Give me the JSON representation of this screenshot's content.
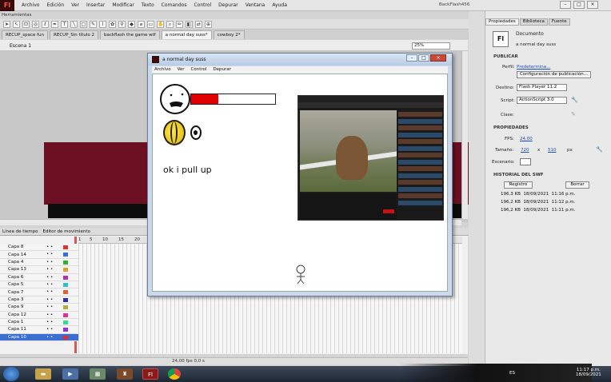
{
  "app": {
    "logo": "Fl",
    "menus": [
      "Archivo",
      "Edición",
      "Ver",
      "Insertar",
      "Modificar",
      "Texto",
      "Comandos",
      "Control",
      "Depurar",
      "Ventana",
      "Ayuda"
    ],
    "project": "BackFlash456",
    "window_controls": [
      "–",
      "□",
      "×"
    ]
  },
  "tools_panel": {
    "label": "Herramientas"
  },
  "doc_tabs": [
    "RECUP_space fun",
    "RECUP_Sin título 2",
    "backflash the game wtf",
    "a normal day suss*",
    "cowboy 2*"
  ],
  "scene": {
    "label": "Escena 1",
    "zoom": "25%"
  },
  "timeline": {
    "tabs": [
      "Línea de tiempo",
      "Editor de movimiento"
    ],
    "ruler": [
      "1",
      "5",
      "10",
      "15",
      "20"
    ],
    "layers": [
      {
        "name": "Capa 8",
        "color": "#e03030"
      },
      {
        "name": "Capa 14",
        "color": "#3070e0"
      },
      {
        "name": "Capa 4",
        "color": "#30b030"
      },
      {
        "name": "Capa 13",
        "color": "#e0a030"
      },
      {
        "name": "Capa 6",
        "color": "#b030b0"
      },
      {
        "name": "Capa 5",
        "color": "#30c0c0"
      },
      {
        "name": "Capa 7",
        "color": "#e06030"
      },
      {
        "name": "Capa 3",
        "color": "#3030b0"
      },
      {
        "name": "Capa 9",
        "color": "#b0b030"
      },
      {
        "name": "Capa 12",
        "color": "#e03090"
      },
      {
        "name": "Capa 1",
        "color": "#30e090"
      },
      {
        "name": "Capa 11",
        "color": "#9030e0"
      },
      {
        "name": "Capa 10",
        "color": "#e03030",
        "selected": true
      }
    ],
    "footer": "24,00 fps  0,0 s"
  },
  "properties": {
    "tabs": [
      "Propiedades",
      "Biblioteca",
      "Fuente"
    ],
    "doc_type": "Documento",
    "doc_name": "a normal day suss",
    "publicar": "PUBLICAR",
    "perfil_label": "Perfil:",
    "perfil_value": "Predetermina...",
    "config_button": "Configuración de publicación...",
    "destino_label": "Destino:",
    "destino_value": "Flash Player 11.2",
    "script_label": "Script:",
    "script_value": "ActionScript 3.0",
    "clase_label": "Clase:",
    "propiedades": "PROPIEDADES",
    "fps_label": "FPS:",
    "fps_value": "24,00",
    "tamano_label": "Tamaño:",
    "width": "720",
    "x_sep": "x",
    "height": "510",
    "px": "px",
    "escenario_label": "Escenario:",
    "historial": "HISTORIAL DEL SWF",
    "registro_button": "Registro",
    "borrar_button": "Borrar",
    "history": [
      {
        "size": "196,3 KB",
        "date": "18/09/2021",
        "time": "11:16 p.m."
      },
      {
        "size": "196,2 KB",
        "date": "18/09/2021",
        "time": "11:12 p.m."
      },
      {
        "size": "196,2 KB",
        "date": "18/09/2021",
        "time": "11:11 p.m."
      }
    ]
  },
  "swf_window": {
    "title": "a normal day suss",
    "menus": [
      "Archivo",
      "Ver",
      "Control",
      "Depurar"
    ],
    "game_text": "ok i pull up",
    "health_fraction": 0.32
  },
  "taskbar": {
    "lang": "ES",
    "time": "11:17 p.m.",
    "date": "18/09/2021"
  },
  "colors": {
    "stage_red": "#6d0f22",
    "health_red": "#e00000",
    "selection_blue": "#3a6ed0"
  }
}
